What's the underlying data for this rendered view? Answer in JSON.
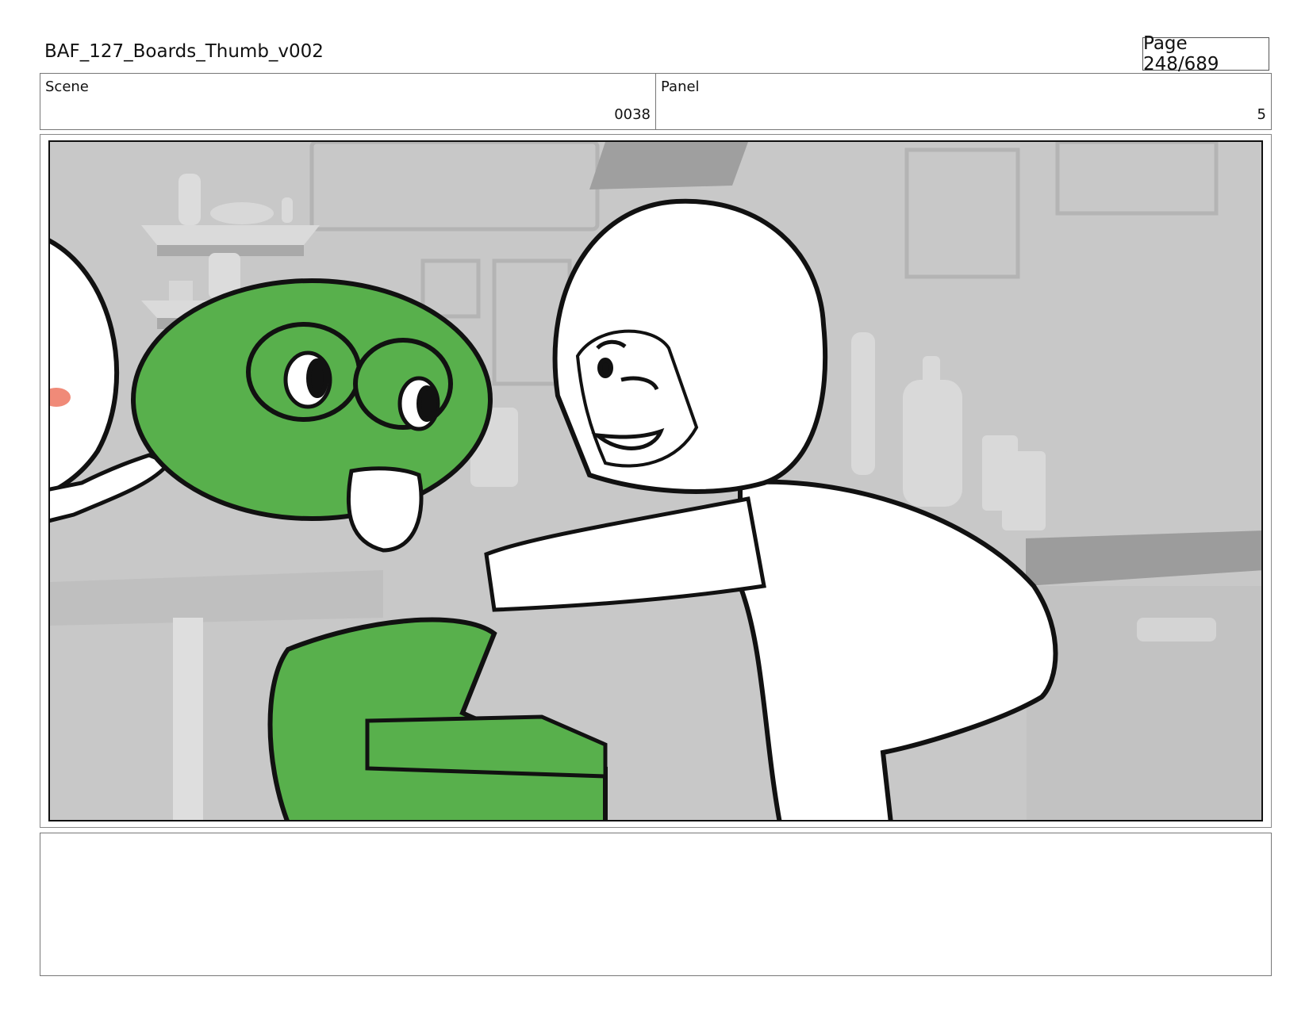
{
  "header": {
    "document_title": "BAF_127_Boards_Thumb_v002",
    "page_indicator": "Page 248/689"
  },
  "info": {
    "scene_label": "Scene",
    "scene_value": "0038",
    "panel_label": "Panel",
    "panel_value": "5"
  },
  "colors": {
    "frog_green": "#58b04c",
    "background_gray": "#c6c6c6",
    "line_black": "#111111",
    "accent_salmon": "#f08a78"
  },
  "notes": {
    "text": ""
  }
}
